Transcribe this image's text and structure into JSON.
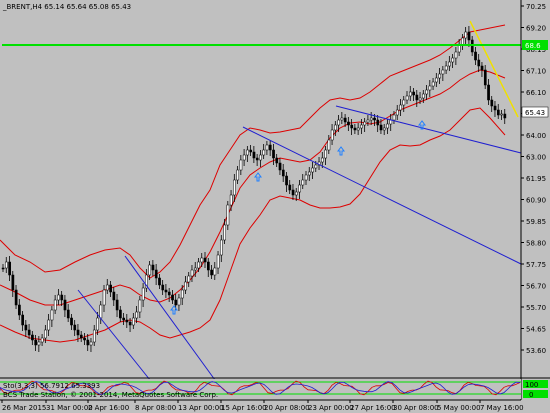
{
  "window": {
    "symbol_info": "_BRENT,H4  65.14 65.64 65.08 65.43"
  },
  "price_axis": {
    "ticks": [
      "70.25",
      "69.20",
      "68.15",
      "67.10",
      "66.10",
      "65.05",
      "64.00",
      "63.00",
      "61.95",
      "60.90",
      "59.85",
      "58.80",
      "57.75",
      "56.70",
      "55.70",
      "54.65",
      "53.60"
    ],
    "current_price": "65.43",
    "level_price": "68.6"
  },
  "time_axis": {
    "labels": [
      "26 Mar 2015",
      "31 Mar 00:00",
      "2 Apr 16:00",
      "8 Apr 08:00",
      "13 Apr 00:00",
      "15 Apr 16:00",
      "20 Apr 08:00",
      "23 Apr 00:00",
      "27 Apr 16:00",
      "30 Apr 08:00",
      "5 May 00:00",
      "7 May 16:00"
    ]
  },
  "indicator": {
    "label": "Sto(3,3,3) 56.7912 65.3393",
    "ticks": [
      "100",
      "0"
    ]
  },
  "copyright": "BCS Trade Station, © 2001-2014, MetaQuotes Software Corp.",
  "colors": {
    "background": "#c0c0c0",
    "grid": "#a8a8a8",
    "candles": "#000000",
    "bands": "#dd0000",
    "trendlines": "#1f1fd0",
    "level": "#00e000",
    "yellow_line": "#f0e000",
    "arrows": "#2080ff"
  }
}
